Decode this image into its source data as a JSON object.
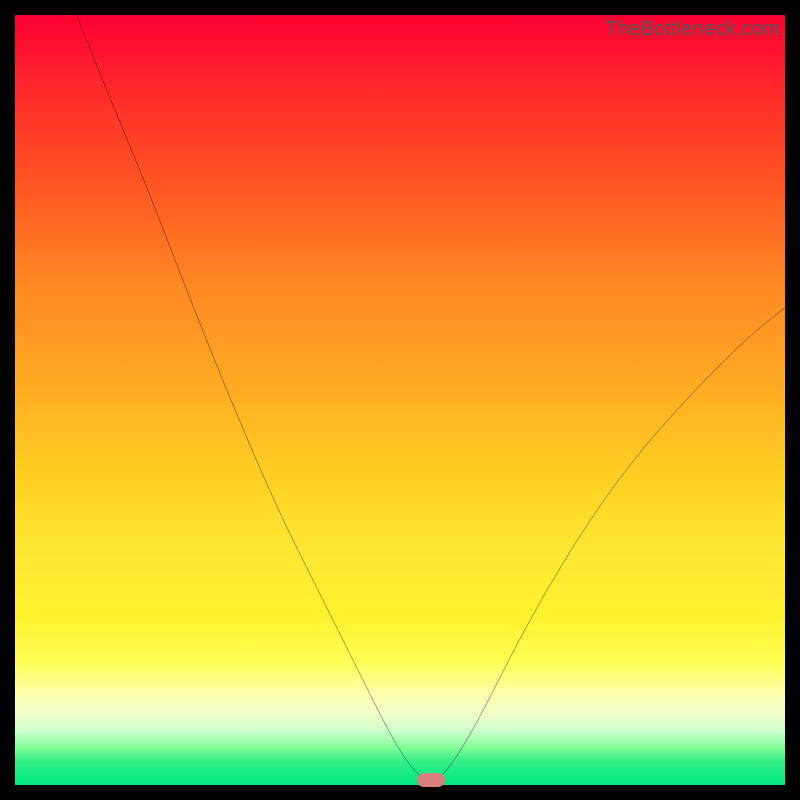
{
  "watermark": "TheBottleneck.com",
  "chart_data": {
    "type": "line",
    "title": "",
    "xlabel": "",
    "ylabel": "",
    "xlim": [
      0,
      100
    ],
    "ylim": [
      0,
      100
    ],
    "grid": false,
    "curve": [
      {
        "x": 8,
        "y": 100
      },
      {
        "x": 12,
        "y": 90
      },
      {
        "x": 17,
        "y": 78
      },
      {
        "x": 22,
        "y": 65
      },
      {
        "x": 28,
        "y": 50
      },
      {
        "x": 34,
        "y": 36
      },
      {
        "x": 40,
        "y": 24
      },
      {
        "x": 45,
        "y": 14
      },
      {
        "x": 49,
        "y": 6
      },
      {
        "x": 52,
        "y": 1.5
      },
      {
        "x": 54,
        "y": 0.5
      },
      {
        "x": 56,
        "y": 1.5
      },
      {
        "x": 60,
        "y": 8
      },
      {
        "x": 66,
        "y": 20
      },
      {
        "x": 73,
        "y": 32
      },
      {
        "x": 80,
        "y": 42
      },
      {
        "x": 88,
        "y": 51
      },
      {
        "x": 95,
        "y": 58
      },
      {
        "x": 100,
        "y": 62
      }
    ],
    "marker": {
      "x": 54,
      "y": 0.7,
      "color": "#d88080"
    },
    "background_gradient": {
      "top": "#ff0033",
      "mid": "#ffd022",
      "bottom": "#00e880"
    }
  }
}
